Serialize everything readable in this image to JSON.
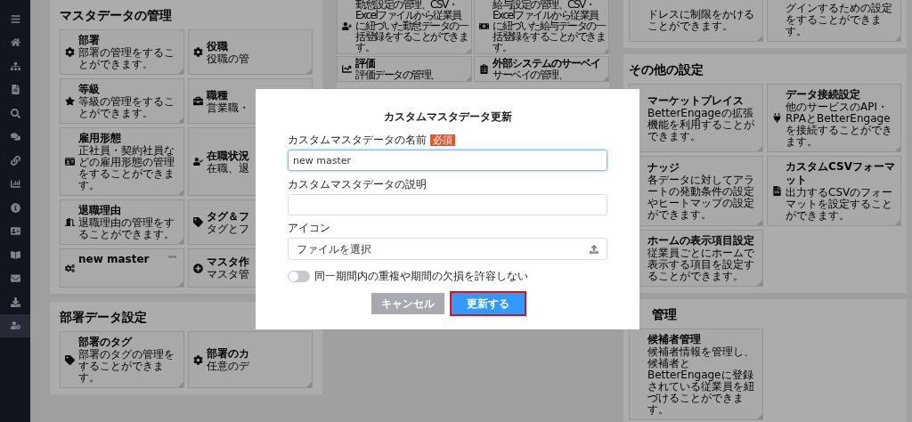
{
  "sidebar": {
    "items": [
      {
        "selected": false
      },
      {
        "selected": false
      },
      {
        "selected": false
      },
      {
        "selected": false
      },
      {
        "selected": false
      },
      {
        "selected": false
      },
      {
        "selected": false
      },
      {
        "selected": false
      },
      {
        "selected": false
      },
      {
        "selected": false
      },
      {
        "selected": false
      },
      {
        "selected": false
      },
      {
        "selected": false
      },
      {
        "selected": true
      }
    ]
  },
  "columns": [
    {
      "panels": [
        {
          "title": "マスタデータの管理",
          "cards": [
            {
              "title": "部署",
              "description": "部署の管理をすることができます。"
            },
            {
              "title": "役職",
              "description": "役職の管"
            },
            {
              "title": "等級",
              "description": "等級の管理をすることができます。"
            },
            {
              "title": "職種",
              "description": "営業職・"
            },
            {
              "title": "雇用形態",
              "description": "正社員・契約社員などの雇用形態の管理をすることができます。"
            },
            {
              "title": "在職状況",
              "description": "在職、退"
            },
            {
              "title": "退職理由",
              "description": "退職理由の管理をすることができます。"
            },
            {
              "title": "タグ＆フ",
              "description": "タグとフ"
            },
            {
              "title": "new master"
            },
            {
              "title": "マスタ作",
              "description": "マスタ管"
            }
          ]
        },
        {
          "title": "部署データ設定",
          "cards": [
            {
              "title": "部署のタグ",
              "description": "部署のタグの管理をすることができます。"
            },
            {
              "title": "部署のカ",
              "description": "任意のデ"
            }
          ]
        }
      ]
    },
    {
      "panels": [
        {
          "cards": [
            {
              "description": "勤怠設定の管理、CSV・Excelファイルから従業員に紐づいた勤怠データの一括登録をすることができます。"
            },
            {
              "description": "給与設定の管理、CSV・Excelファイルから従業員に紐づいた給与データの一括登録をすることができます。"
            },
            {
              "title": "評価",
              "description": "評価データの管理、"
            },
            {
              "title": "外部システムのサーベイ",
              "description": "サーベイの管理、"
            }
          ]
        }
      ]
    },
    {
      "panels": [
        {
          "cards": [
            {
              "description": "ドレスに制限をかけることができます。"
            },
            {
              "description": "グインするための設定をすることができます。"
            }
          ]
        },
        {
          "title": "その他の設定",
          "cards": [
            {
              "title": "マーケットプレイス",
              "description": "BetterEngageの拡張機能を利用することができます。"
            },
            {
              "title": "データ接続設定",
              "description": "他のサービスのAPI・RPAとBetterEngageを接続することができます。"
            },
            {
              "title": "ナッジ",
              "description": "各データに対してアラートの発動条件の設定やヒートマップの設定ができます。"
            },
            {
              "title": "カスタムCSVフォーマット",
              "description": "出力するCSVのフォーマットを設定することができます。"
            },
            {
              "title": "ホームの表示項目設定",
              "description": "従業員ごとにホームで表示する項目を設定することができます。"
            }
          ]
        },
        {
          "title": "管理",
          "cards": [
            {
              "title": "候補者管理",
              "description": "候補者情報を管理し、候補者とBetterEngageに登録されている従業員を紐づけることができます。"
            }
          ]
        }
      ]
    }
  ],
  "dialog": {
    "title": "カスタムマスタデータ更新",
    "name_field": {
      "label": "カスタムマスタデータの名前",
      "badge": "必須",
      "value": "new master",
      "focused": true
    },
    "description_field": {
      "label": "カスタムマスタデータの説明",
      "focused": false
    },
    "icon_field": {
      "label": "アイコン",
      "placeholder": "ファイルを選択"
    },
    "toggle": {
      "label": "同一期間内の重複や期間の欠損を許容しない",
      "on": false
    },
    "buttons": [
      {
        "label": "キャンセル",
        "kind": "cancel",
        "disabled": true,
        "highlighted": false
      },
      {
        "label": "更新する",
        "kind": "primary",
        "disabled": false,
        "highlighted": true
      }
    ]
  }
}
